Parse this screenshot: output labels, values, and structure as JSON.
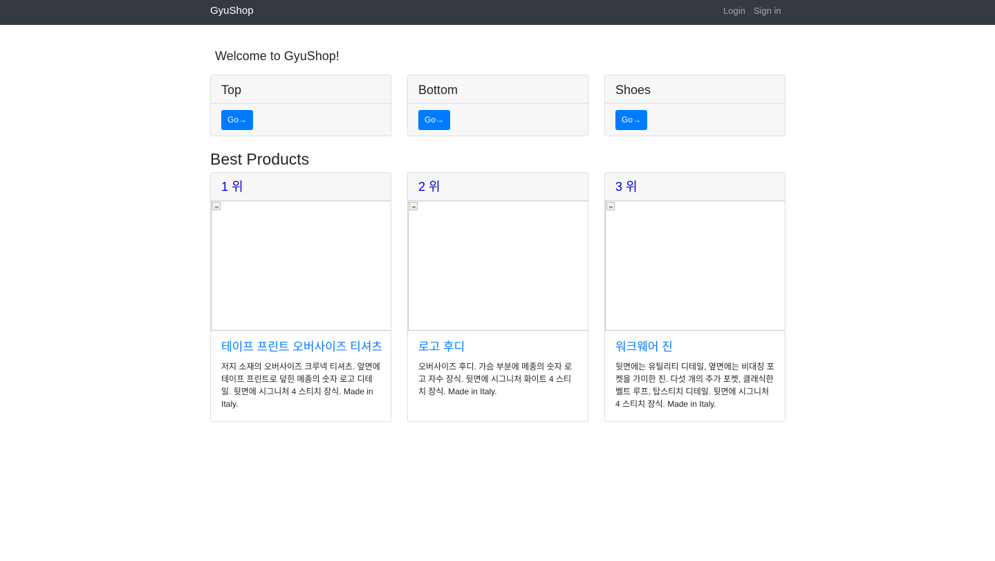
{
  "navbar": {
    "brand": "GyuShop",
    "links": [
      "Login",
      "Sign in"
    ]
  },
  "welcome": "Welcome to GyuShop!",
  "categories": [
    {
      "title": "Top",
      "button": "Go→"
    },
    {
      "title": "Bottom",
      "button": "Go→"
    },
    {
      "title": "Shoes",
      "button": "Go→"
    }
  ],
  "best_products": {
    "title": "Best Products",
    "items": [
      {
        "rank": "1 위",
        "name": "테이프 프린트 오버사이즈 티셔츠",
        "description": "저지 소재의 오버사이즈 크루넥 티셔츠. 앞면에 테이프 프린트로 덮힌 메종의 숫자 로고 디테일. 뒷면에 시그니처 4 스티치 장식. Made in Italy."
      },
      {
        "rank": "2 위",
        "name": "로고 후디",
        "description": "오버사이즈 후디. 가슴 부분에 메종의 숫자 로고 자수 장식. 뒷면에 시그니처 화이트 4 스티치 장식. Made in Italy."
      },
      {
        "rank": "3 위",
        "name": "워크웨어 진",
        "description": "뒷면에는 유틸리티 디테일, 옆면에는 비대칭 포켓을 가미한 진. 다섯 개의 추가 포켓, 클래식한 벨트 루프, 탑스티치 디테일. 뒷면에 시그니처 4 스티치 장식. Made in Italy."
      }
    ]
  }
}
